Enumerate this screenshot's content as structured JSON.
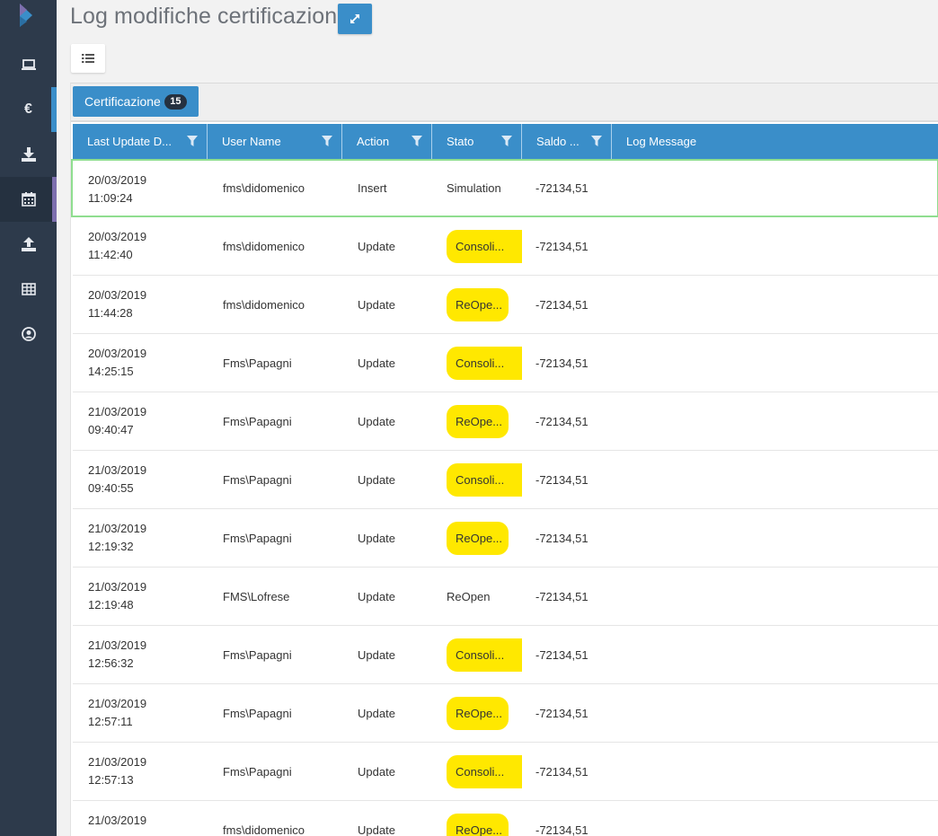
{
  "page": {
    "title": "Log modifiche certificazioni"
  },
  "sidebar": {
    "items": [
      {
        "icon": "laptop-icon"
      },
      {
        "icon": "euro-icon",
        "glyph": "€"
      },
      {
        "icon": "download-icon"
      },
      {
        "icon": "calendar-icon",
        "active": true
      },
      {
        "icon": "upload-icon"
      },
      {
        "icon": "table-icon"
      },
      {
        "icon": "user-circle-icon"
      }
    ]
  },
  "tab": {
    "label": "Certificazione",
    "count": "15"
  },
  "grid": {
    "columns": [
      {
        "label": "Last Update D...",
        "filter": true
      },
      {
        "label": "User Name",
        "filter": true
      },
      {
        "label": "Action",
        "filter": true
      },
      {
        "label": "Stato",
        "filter": true
      },
      {
        "label": "Saldo ...",
        "filter": true
      },
      {
        "label": "Log Message",
        "filter": false
      }
    ],
    "rows": [
      {
        "date": "20/03/2019",
        "time": "11:09:24",
        "user": "fms\\didomenico",
        "action": "Insert",
        "stato": "Simulation",
        "stato_style": "plain",
        "saldo": "-72134,51",
        "log": ""
      },
      {
        "date": "20/03/2019",
        "time": "11:42:40",
        "user": "fms\\didomenico",
        "action": "Update",
        "stato": "Consoli...",
        "stato_style": "pill-wide",
        "saldo": "-72134,51",
        "log": ""
      },
      {
        "date": "20/03/2019",
        "time": "11:44:28",
        "user": "fms\\didomenico",
        "action": "Update",
        "stato": "ReOpe...",
        "stato_style": "pill-narrow",
        "saldo": "-72134,51",
        "log": ""
      },
      {
        "date": "20/03/2019",
        "time": "14:25:15",
        "user": "Fms\\Papagni",
        "action": "Update",
        "stato": "Consoli...",
        "stato_style": "pill-wide",
        "saldo": "-72134,51",
        "log": ""
      },
      {
        "date": "21/03/2019",
        "time": "09:40:47",
        "user": "Fms\\Papagni",
        "action": "Update",
        "stato": "ReOpe...",
        "stato_style": "pill-narrow",
        "saldo": "-72134,51",
        "log": ""
      },
      {
        "date": "21/03/2019",
        "time": "09:40:55",
        "user": "Fms\\Papagni",
        "action": "Update",
        "stato": "Consoli...",
        "stato_style": "pill-wide",
        "saldo": "-72134,51",
        "log": ""
      },
      {
        "date": "21/03/2019",
        "time": "12:19:32",
        "user": "Fms\\Papagni",
        "action": "Update",
        "stato": "ReOpe...",
        "stato_style": "pill-narrow",
        "saldo": "-72134,51",
        "log": ""
      },
      {
        "date": "21/03/2019",
        "time": "12:19:48",
        "user": "FMS\\Lofrese",
        "action": "Update",
        "stato": "ReOpen",
        "stato_style": "plain",
        "saldo": "-72134,51",
        "log": ""
      },
      {
        "date": "21/03/2019",
        "time": "12:56:32",
        "user": "Fms\\Papagni",
        "action": "Update",
        "stato": "Consoli...",
        "stato_style": "pill-wide",
        "saldo": "-72134,51",
        "log": ""
      },
      {
        "date": "21/03/2019",
        "time": "12:57:11",
        "user": "Fms\\Papagni",
        "action": "Update",
        "stato": "ReOpe...",
        "stato_style": "pill-narrow",
        "saldo": "-72134,51",
        "log": ""
      },
      {
        "date": "21/03/2019",
        "time": "12:57:13",
        "user": "Fms\\Papagni",
        "action": "Update",
        "stato": "Consoli...",
        "stato_style": "pill-wide",
        "saldo": "-72134,51",
        "log": ""
      },
      {
        "date": "21/03/2019",
        "time": "",
        "user": "fms\\didomenico",
        "action": "Update",
        "stato": "ReOpe...",
        "stato_style": "pill-narrow",
        "saldo": "-72134,51",
        "log": ""
      }
    ]
  },
  "colors": {
    "sidebar": "#2d3a4b",
    "accent": "#3a8ec9",
    "pill": "#ffe800",
    "selected_border": "#8fde8f"
  }
}
